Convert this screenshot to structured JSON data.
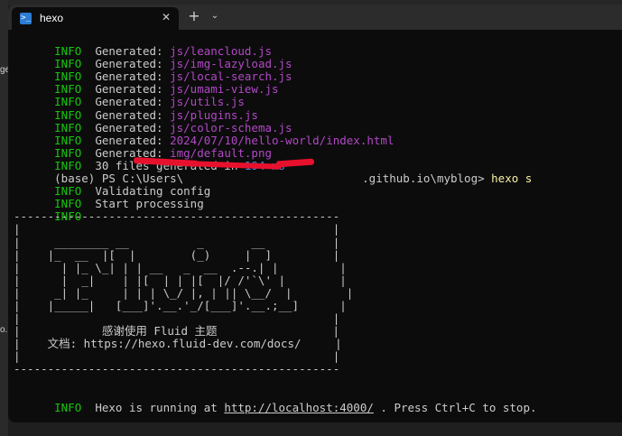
{
  "left_strip": {
    "fragments": [
      "ge",
      "o.i"
    ]
  },
  "titlebar": {
    "tab": {
      "icon_glyph": ">_",
      "title": "hexo",
      "close_glyph": "✕"
    },
    "new_tab_glyph": "+",
    "dropdown_glyph": "⌄"
  },
  "terminal": {
    "generated": [
      {
        "prefix": "INFO",
        "label": "  Generated: ",
        "file": "js/leancloud.js"
      },
      {
        "prefix": "INFO",
        "label": "  Generated: ",
        "file": "js/img-lazyload.js"
      },
      {
        "prefix": "INFO",
        "label": "  Generated: ",
        "file": "js/local-search.js"
      },
      {
        "prefix": "INFO",
        "label": "  Generated: ",
        "file": "js/umami-view.js"
      },
      {
        "prefix": "INFO",
        "label": "  Generated: ",
        "file": "js/utils.js"
      },
      {
        "prefix": "INFO",
        "label": "  Generated: ",
        "file": "js/plugins.js"
      },
      {
        "prefix": "INFO",
        "label": "  Generated: ",
        "file": "js/color-schema.js"
      },
      {
        "prefix": "INFO",
        "label": "  Generated: ",
        "file": "2024/07/10/hello-world/index.html"
      },
      {
        "prefix": "INFO",
        "label": "  Generated: ",
        "file": "img/default.png"
      }
    ],
    "summary": {
      "prefix": "INFO",
      "text": "  30 files generated in ",
      "time": "194 ms"
    },
    "prompt": {
      "text_before": "(base) PS C:\\Users\\",
      "text_after": ".github.io\\myblog> ",
      "command": "hexo s"
    },
    "validating": {
      "prefix": "INFO",
      "text": "  Validating config"
    },
    "processing": {
      "prefix": "INFO",
      "text": "  Start processing"
    },
    "empty_info": {
      "prefix": "INFO"
    },
    "banner": "------------------------------------------------\n|                                              |\n|     ________ __          _       __          |\n|    |_  __  |[  |        (_)     |  ]         |\n|      | |_ \\_| | | __   _  __  .--.| |         |\n|      |  _|    | |[  | | |[  |/ /'`\\' |        |\n|     _| |_     | | | \\_/ |, | || \\__/  |        |\n|    |_____|   [___]'.__.'_/[___]'.__.;__]      |\n|                                              |\n|            感谢使用 Fluid 主题                 |\n|    文档: https://hexo.fluid-dev.com/docs/     |\n|                                              |\n------------------------------------------------",
    "running": {
      "prefix": "INFO",
      "before": "  Hexo is running at ",
      "url": "http://localhost:4000/",
      "after": " . Press Ctrl+C to stop."
    }
  }
}
